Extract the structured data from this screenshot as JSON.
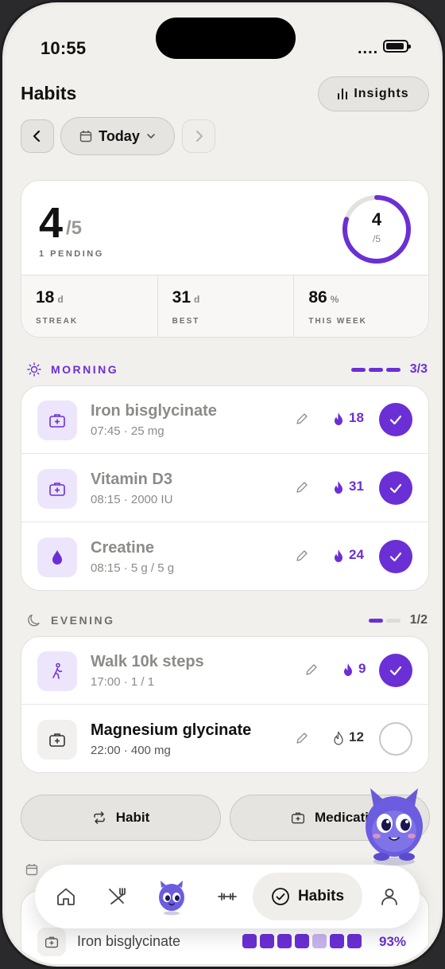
{
  "status_bar": {
    "time": "10:55",
    "signal": "...."
  },
  "header": {
    "title": "Habits",
    "insights_label": "Insights"
  },
  "date_nav": {
    "label": "Today"
  },
  "summary": {
    "done": "4",
    "total": "/5",
    "pending_label": "1 PENDING",
    "ring_done": "4",
    "ring_total": "/5",
    "ring_fraction": 0.8,
    "stats": [
      {
        "value": "18",
        "unit": "d",
        "label": "STREAK"
      },
      {
        "value": "31",
        "unit": "d",
        "label": "BEST"
      },
      {
        "value": "86",
        "unit": "%",
        "label": "THIS WEEK"
      }
    ]
  },
  "morning": {
    "label": "MORNING",
    "count": "3/3",
    "progress": [
      true,
      true,
      true
    ],
    "items": [
      {
        "name": "Iron bisglycinate",
        "detail": "07:45 · 25 mg",
        "streak": "18",
        "icon": "medkit-icon",
        "done": true
      },
      {
        "name": "Vitamin D3",
        "detail": "08:15 · 2000 IU",
        "streak": "31",
        "icon": "medkit-icon",
        "done": true
      },
      {
        "name": "Creatine",
        "detail": "08:15 · 5 g / 5 g",
        "streak": "24",
        "icon": "drop-icon",
        "done": true
      }
    ]
  },
  "evening": {
    "label": "EVENING",
    "count": "1/2",
    "progress": [
      true,
      false
    ],
    "items": [
      {
        "name": "Walk 10k steps",
        "detail": "17:00 · 1 / 1",
        "streak": "9",
        "icon": "walk-icon",
        "done": true
      },
      {
        "name": "Magnesium glycinate",
        "detail": "22:00 · 400 mg",
        "streak": "12",
        "icon": "medkit-icon",
        "done": false
      }
    ]
  },
  "actions": {
    "habit_label": "Habit",
    "medication_label": "Medicati"
  },
  "peek": {
    "name": "Iron bisglycinate",
    "percent": "93%",
    "week": [
      1,
      1,
      1,
      1,
      0.5,
      1,
      1
    ]
  },
  "tabbar": {
    "active_label": "Habits"
  },
  "colors": {
    "accent": "#6b2fd6",
    "accent_light": "#ece5fb",
    "background": "#f1f0ed"
  }
}
